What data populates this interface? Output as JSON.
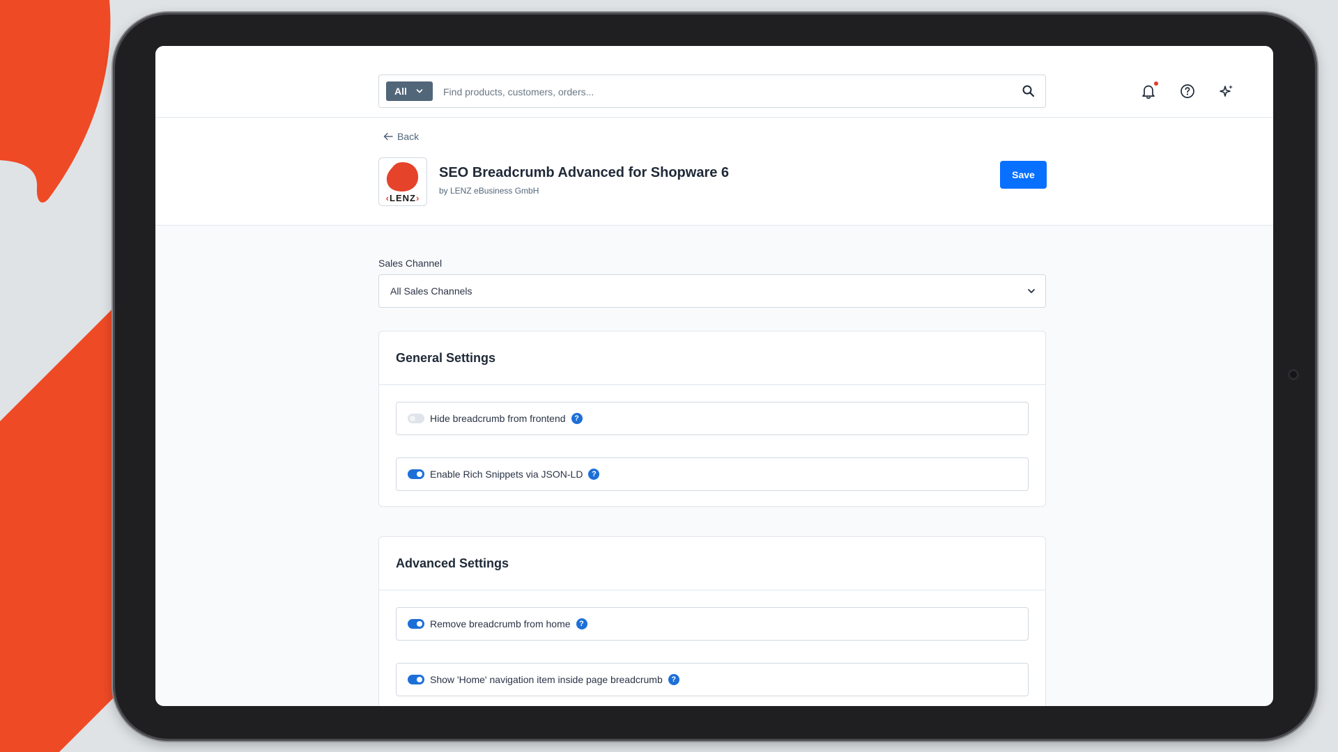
{
  "search": {
    "scope_label": "All",
    "placeholder": "Find products, customers, orders..."
  },
  "topbar": {
    "icons": [
      "bell-icon",
      "help-circle-icon",
      "sparkle-icon"
    ],
    "notification_dot_color": "#e03e2d"
  },
  "header": {
    "back_label": "Back",
    "app_logo_text": "LENZ",
    "app_title": "SEO Breadcrumb Advanced for Shopware 6",
    "app_vendor": "by LENZ eBusiness GmbH",
    "save_label": "Save"
  },
  "sales_channel": {
    "label": "Sales Channel",
    "selected": "All Sales Channels"
  },
  "general_settings": {
    "title": "General Settings",
    "items": [
      {
        "label": "Hide breadcrumb from frontend",
        "enabled": false
      },
      {
        "label": "Enable Rich Snippets via JSON-LD",
        "enabled": true
      }
    ]
  },
  "advanced_settings": {
    "title": "Advanced Settings",
    "items": [
      {
        "label": "Remove breadcrumb from home",
        "enabled": true
      },
      {
        "label": "Show 'Home' navigation item inside page breadcrumb",
        "enabled": true
      }
    ]
  },
  "help_glyph": "?",
  "colors": {
    "brand_orange": "#ef4a26",
    "primary_blue": "#0870ff",
    "toggle_on": "#1d6fd8",
    "scope_bg": "#52667a"
  }
}
